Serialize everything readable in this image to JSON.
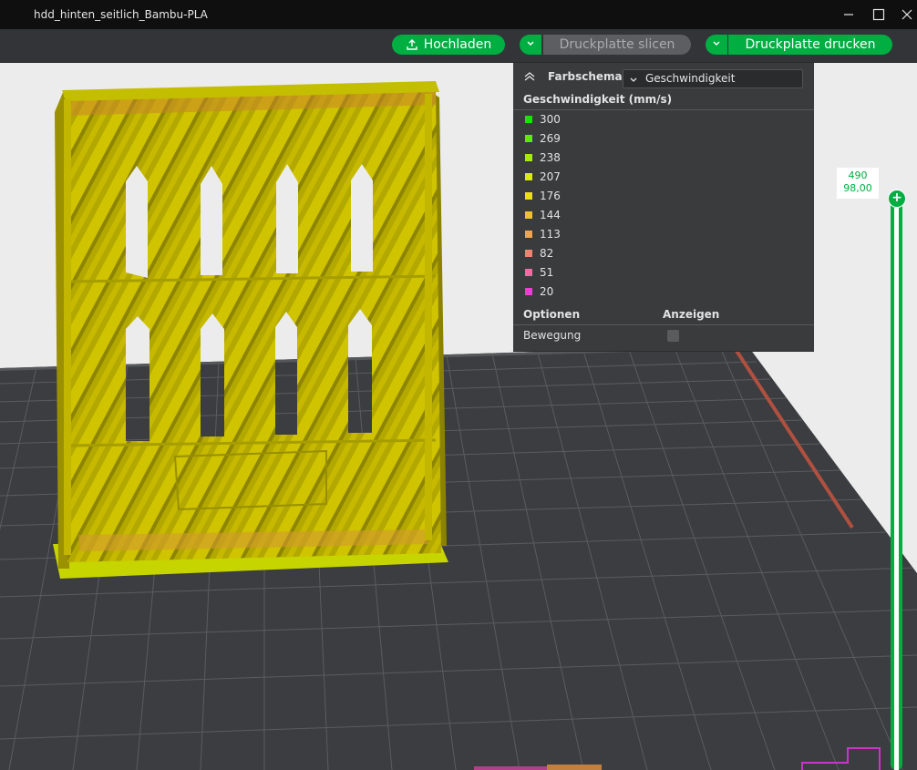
{
  "window": {
    "title": "hdd_hinten_seitlich_Bambu-PLA",
    "minimize_icon": "minimize-icon",
    "maximize_icon": "maximize-icon",
    "close_icon": "close-icon"
  },
  "toolbar": {
    "upload_label": "Hochladen",
    "slice_label": "Druckplatte slicen",
    "print_label": "Druckplatte drucken",
    "accent": "#00ae42"
  },
  "legend": {
    "title": "Farbschema",
    "scheme_value": "Geschwindigkeit",
    "subtitle": "Geschwindigkeit (mm/s)",
    "entries": [
      {
        "value": "300",
        "color": "#17e500"
      },
      {
        "value": "269",
        "color": "#5ee80c"
      },
      {
        "value": "238",
        "color": "#a7ea13"
      },
      {
        "value": "207",
        "color": "#d9ea16"
      },
      {
        "value": "176",
        "color": "#ecdf17"
      },
      {
        "value": "144",
        "color": "#edc12a"
      },
      {
        "value": "113",
        "color": "#f0a350"
      },
      {
        "value": "82",
        "color": "#ef8372"
      },
      {
        "value": "51",
        "color": "#ed6ca2"
      },
      {
        "value": "20",
        "color": "#e83fd4"
      }
    ],
    "options_label": "Optionen",
    "show_label": "Anzeigen",
    "movement_label": "Bewegung"
  },
  "layer_slider": {
    "layer": "490",
    "height": "98,00"
  }
}
